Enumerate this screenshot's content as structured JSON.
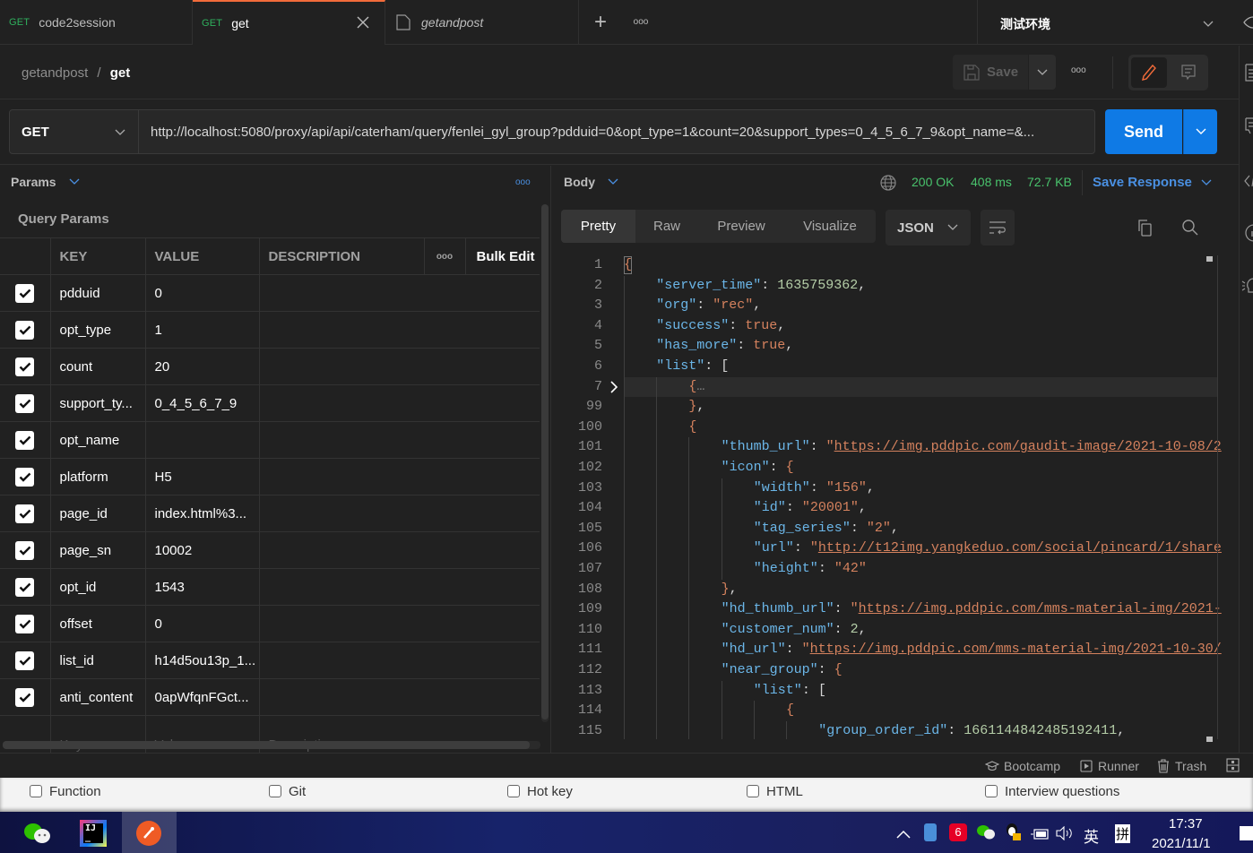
{
  "tabs": [
    {
      "method": "GET",
      "title": "code2session",
      "active": false
    },
    {
      "method": "GET",
      "title": "get",
      "active": true
    },
    {
      "method": "",
      "title": "getandpost",
      "italic": true,
      "active": false
    }
  ],
  "tabbar": {
    "add_label": "+",
    "more_label": "ooo"
  },
  "environment": {
    "selected": "测试环境"
  },
  "breadcrumb": {
    "collection": "getandpost",
    "separator": "/",
    "request": "get"
  },
  "toolbar": {
    "save_label": "Save",
    "more_label": "ooo"
  },
  "request": {
    "method": "GET",
    "url": "http://localhost:5080/proxy/api/api/caterham/query/fenlei_gyl_group?pdduid=0&opt_type=1&count=20&support_types=0_4_5_6_7_9&opt_name=&...",
    "send_label": "Send"
  },
  "params": {
    "section_label": "Params",
    "more_label": "ooo",
    "title": "Query Params",
    "columns": {
      "key": "KEY",
      "value": "VALUE",
      "description": "DESCRIPTION",
      "more": "ooo",
      "bulk_edit": "Bulk Edit"
    },
    "rows": [
      {
        "key": "pdduid",
        "value": "0",
        "checked": true
      },
      {
        "key": "opt_type",
        "value": "1",
        "checked": true
      },
      {
        "key": "count",
        "value": "20",
        "checked": true
      },
      {
        "key": "support_ty...",
        "value": "0_4_5_6_7_9",
        "checked": true
      },
      {
        "key": "opt_name",
        "value": "",
        "checked": true
      },
      {
        "key": "platform",
        "value": "H5",
        "checked": true
      },
      {
        "key": "page_id",
        "value": "index.html%3...",
        "checked": true
      },
      {
        "key": "page_sn",
        "value": "10002",
        "checked": true
      },
      {
        "key": "opt_id",
        "value": "1543",
        "checked": true
      },
      {
        "key": "offset",
        "value": "0",
        "checked": true
      },
      {
        "key": "list_id",
        "value": "h14d5ou13p_1...",
        "checked": true
      },
      {
        "key": "anti_content",
        "value": "0apWfqnFGct...",
        "checked": true
      }
    ],
    "placeholder": {
      "key": "Key",
      "value": "Value",
      "description": "Description"
    }
  },
  "response": {
    "section_label": "Body",
    "status": "200 OK",
    "time": "408 ms",
    "size": "72.7 KB",
    "save_label": "Save Response",
    "view_tabs": [
      "Pretty",
      "Raw",
      "Preview",
      "Visualize"
    ],
    "active_view": "Pretty",
    "format": "JSON",
    "status_color": "#49c26c",
    "lines": [
      {
        "n": "1",
        "indent": 0,
        "html": "<span class='b'>{</span>"
      },
      {
        "n": "2",
        "indent": 1,
        "html": "<span class='k'>\"server_time\"</span>: <span class='n'>1635759362</span>,"
      },
      {
        "n": "3",
        "indent": 1,
        "html": "<span class='k'>\"org\"</span>: <span class='s'>\"rec\"</span>,"
      },
      {
        "n": "4",
        "indent": 1,
        "html": "<span class='k'>\"success\"</span>: <span class='s'>true</span>,"
      },
      {
        "n": "5",
        "indent": 1,
        "html": "<span class='k'>\"has_more\"</span>: <span class='s'>true</span>,"
      },
      {
        "n": "6",
        "indent": 1,
        "html": "<span class='k'>\"list\"</span>: ["
      },
      {
        "n": "7",
        "indent": 2,
        "html": "<span class='b'>{</span><span style='color:#888'>…</span>",
        "folded": true
      },
      {
        "n": "99",
        "indent": 2,
        "html": "<span class='b'>}</span>,"
      },
      {
        "n": "100",
        "indent": 2,
        "html": "<span class='b'>{</span>"
      },
      {
        "n": "101",
        "indent": 3,
        "html": "<span class='k'>\"thumb_url\"</span>: <span class='s'>\"</span><span class='u'>https://img.pddpic.com/gaudit-image/2021-10-08/2</span>"
      },
      {
        "n": "102",
        "indent": 3,
        "html": "<span class='k'>\"icon\"</span>: <span class='b'>{</span>"
      },
      {
        "n": "103",
        "indent": 4,
        "html": "<span class='k'>\"width\"</span>: <span class='s'>\"156\"</span>,"
      },
      {
        "n": "104",
        "indent": 4,
        "html": "<span class='k'>\"id\"</span>: <span class='s'>\"20001\"</span>,"
      },
      {
        "n": "105",
        "indent": 4,
        "html": "<span class='k'>\"tag_series\"</span>: <span class='s'>\"2\"</span>,"
      },
      {
        "n": "106",
        "indent": 4,
        "html": "<span class='k'>\"url\"</span>: <span class='s'>\"</span><span class='u'>http://t12img.yangkeduo.com/social/pincard/1/share</span>"
      },
      {
        "n": "107",
        "indent": 4,
        "html": "<span class='k'>\"height\"</span>: <span class='s'>\"42\"</span>"
      },
      {
        "n": "108",
        "indent": 3,
        "html": "<span class='b'>}</span>,"
      },
      {
        "n": "109",
        "indent": 3,
        "html": "<span class='k'>\"hd_thumb_url\"</span>: <span class='s'>\"</span><span class='u'>https://img.pddpic.com/mms-material-img/2021-</span>"
      },
      {
        "n": "110",
        "indent": 3,
        "html": "<span class='k'>\"customer_num\"</span>: <span class='n'>2</span>,"
      },
      {
        "n": "111",
        "indent": 3,
        "html": "<span class='k'>\"hd_url\"</span>: <span class='s'>\"</span><span class='u'>https://img.pddpic.com/mms-material-img/2021-10-30/</span>"
      },
      {
        "n": "112",
        "indent": 3,
        "html": "<span class='k'>\"near_group\"</span>: <span class='b'>{</span>"
      },
      {
        "n": "113",
        "indent": 4,
        "html": "<span class='k'>\"list\"</span>: ["
      },
      {
        "n": "114",
        "indent": 5,
        "html": "<span class='b'>{</span>"
      },
      {
        "n": "115",
        "indent": 6,
        "html": "<span class='k'>\"group_order_id\"</span>: <span class='n'>1661144842485192411</span>,"
      }
    ]
  },
  "statusbar": {
    "bootcamp": "Bootcamp",
    "runner": "Runner",
    "trash": "Trash"
  },
  "strip": {
    "items": [
      {
        "label": "Function",
        "checked": false
      },
      {
        "label": "Git",
        "checked": false
      },
      {
        "label": "Hot key",
        "checked": false
      },
      {
        "label": "HTML",
        "checked": false
      },
      {
        "label": "Interview questions",
        "checked": false
      }
    ]
  },
  "taskbar": {
    "apps": [
      "wechat-icon",
      "intellij-icon",
      "postman-icon"
    ],
    "ime_lang": "英",
    "ime_mode": "拼",
    "time": "17:37",
    "date": "2021/11/1"
  }
}
